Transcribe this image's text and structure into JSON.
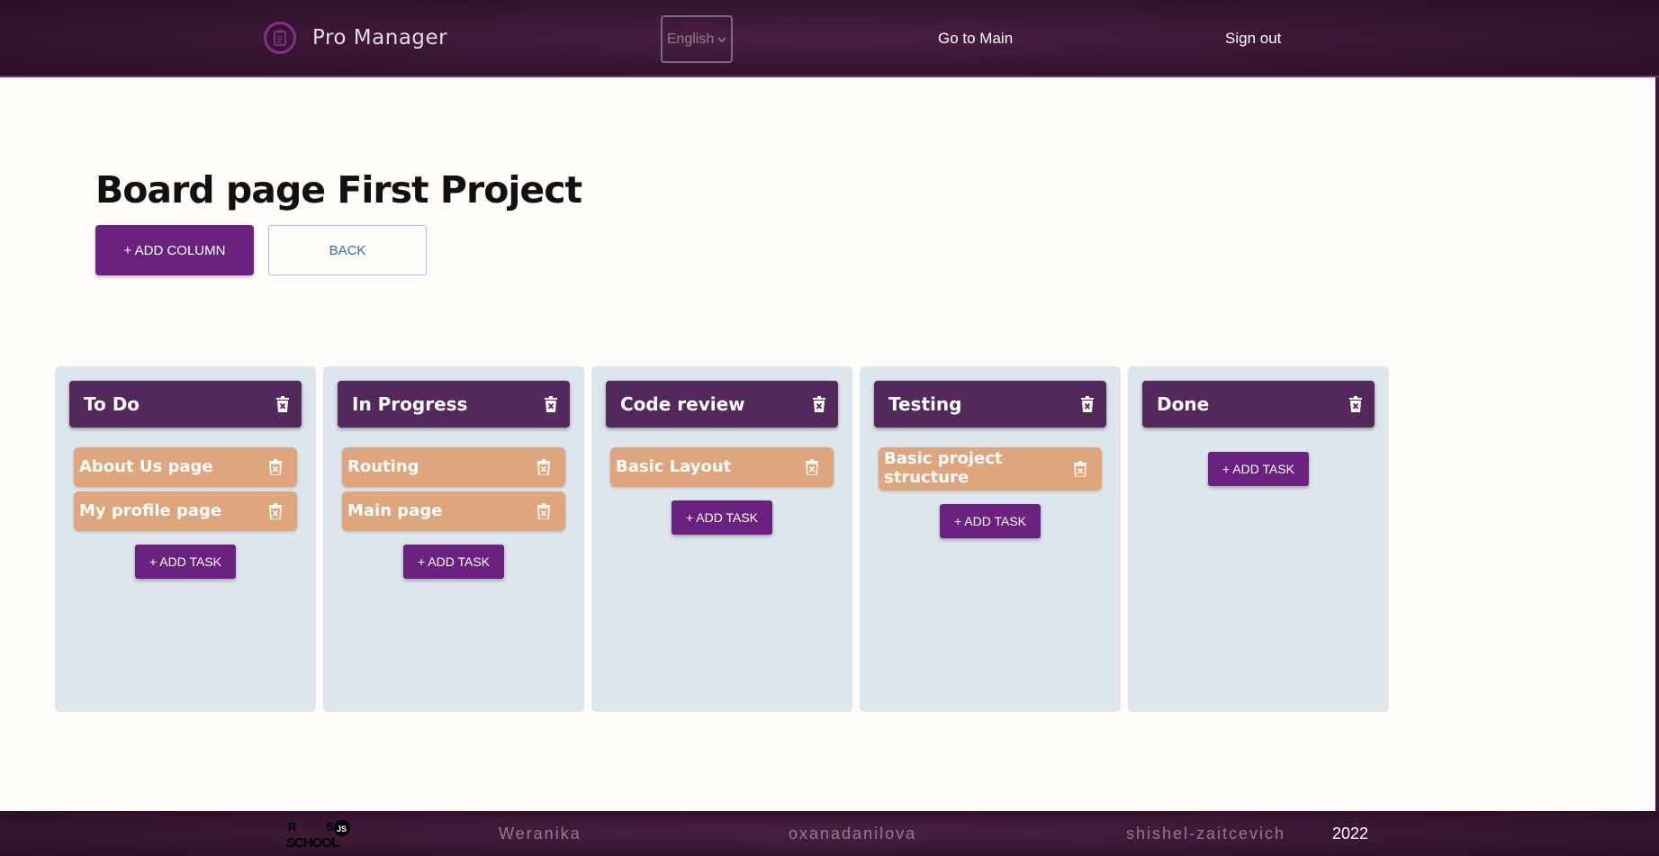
{
  "header": {
    "app_title": "Pro Manager",
    "language_selected": "English",
    "nav_main": "Go to Main",
    "nav_signout": "Sign out"
  },
  "page": {
    "title": "Board page First Project",
    "add_column_label": "+ ADD COLUMN",
    "back_label": "BACK"
  },
  "columns": [
    {
      "title": "To Do",
      "tasks": [
        "About Us page",
        "My profile page"
      ],
      "add_task_label": "+ ADD TASK"
    },
    {
      "title": "In Progress",
      "tasks": [
        "Routing",
        "Main page"
      ],
      "add_task_label": "+ ADD TASK"
    },
    {
      "title": "Code review",
      "tasks": [
        "Basic Layout"
      ],
      "add_task_label": "+ ADD TASK"
    },
    {
      "title": "Testing",
      "tasks": [
        "Basic project structure"
      ],
      "add_task_label": "+ ADD TASK"
    },
    {
      "title": "Done",
      "tasks": [],
      "add_task_label": "+ ADD TASK"
    }
  ],
  "footer": {
    "logo_text": "RS SCHOOL",
    "authors": [
      "Weranika",
      "oxanadanilova",
      "shishel-zaitcevich"
    ],
    "year": "2022"
  },
  "colors": {
    "header_bg": "#3a1735",
    "primary_button": "#6b2180",
    "column_header": "#52285d",
    "column_bg": "#dde6ed",
    "task_bg": "#dfa67e",
    "back_button_text": "#2b6db3"
  },
  "icons": {
    "app_logo": "clipboard-icon",
    "delete": "trash-icon",
    "select_arrow": "chevron-down-icon"
  }
}
